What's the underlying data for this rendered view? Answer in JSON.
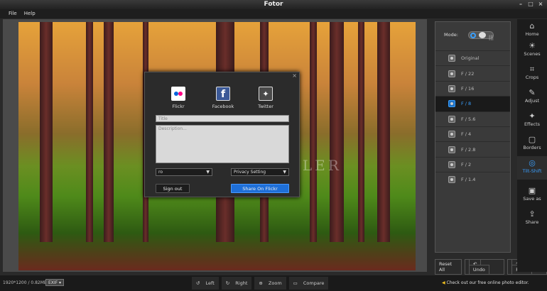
{
  "window": {
    "title": "Fotor",
    "minimize": "–",
    "maximize": "□",
    "close": "×"
  },
  "menu": [
    "File",
    "Help"
  ],
  "watermark": "GEZGINLER",
  "dialog": {
    "close": "×",
    "services": [
      {
        "name": "Flickr",
        "color": "#ffffff"
      },
      {
        "name": "Facebook",
        "color": "#3b5998"
      },
      {
        "name": "Twitter",
        "color": "#4a4a4a"
      }
    ],
    "title_placeholder": "Title",
    "description_placeholder": "Description...",
    "account_select": "ro",
    "privacy_select": "Privacy Setting",
    "signout_label": "Sign out",
    "share_label": "Share On Flickr"
  },
  "panel": {
    "mode_label": "Mode:",
    "filters": [
      "Original",
      "F / 22",
      "F / 16",
      "F / 8",
      "F / 5.6",
      "F / 4",
      "F / 2.8",
      "F / 2",
      "F / 1.4"
    ],
    "selected": 3,
    "reset_label": "Reset All",
    "undo_label": "Undo",
    "redo_label": "Redo"
  },
  "sidebar": [
    {
      "label": "Home",
      "icon": "home-icon"
    },
    {
      "label": "Scenes",
      "icon": "sun-icon"
    },
    {
      "label": "Crops",
      "icon": "crop-icon"
    },
    {
      "label": "Adjust",
      "icon": "pencil-icon"
    },
    {
      "label": "Effects",
      "icon": "sparkle-icon"
    },
    {
      "label": "Borders",
      "icon": "frame-icon"
    },
    {
      "label": "Tilt-Shift",
      "icon": "tiltshift-icon"
    },
    {
      "label": "Save as",
      "icon": "save-icon"
    },
    {
      "label": "Share",
      "icon": "share-icon"
    }
  ],
  "status": {
    "info": "1920*1200 / 0.82MB",
    "exif": "EXIF",
    "tools": [
      "Left",
      "Right",
      "Zoom",
      "Compare"
    ],
    "promo": "Check out our free online photo editor."
  },
  "colors": {
    "accent": "#3aa0ff",
    "share_button": "#1e6fd8"
  }
}
